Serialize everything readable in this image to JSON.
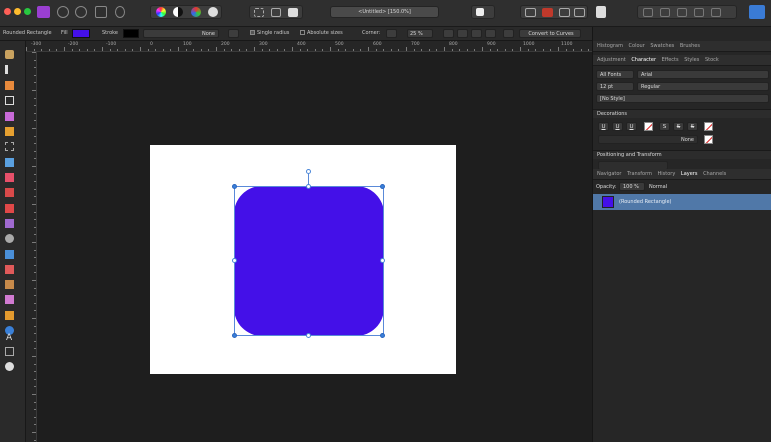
{
  "toolbar": {
    "doc_title": "<Untitled> [150.0%]",
    "icons": [
      "designer-persona-icon",
      "pixel-persona-icon",
      "export-persona-icon",
      "share-icon",
      "color-wheel-icon",
      "tone-icon",
      "color-icon",
      "snapping-icon",
      "order-icon",
      "align-icon",
      "boolean-icon",
      "help-icon",
      "studio-icon",
      "search-icon"
    ]
  },
  "context": {
    "object_label": "Rounded Rectangle",
    "fill_label": "Fill",
    "fill_color": "#4410e8",
    "stroke_label": "Stroke",
    "stroke_color": "#000000",
    "stroke_value": "None",
    "single_radius_label": "Single radius",
    "absolute_sizes_label": "Absolute sizes",
    "corner_label": "Corner:",
    "corner_value": "25 %",
    "convert_label": "Convert to Curves"
  },
  "ruler": {
    "top_labels": [
      "-300",
      "-200",
      "-100",
      "0",
      "100",
      "200",
      "300",
      "400",
      "500",
      "600",
      "700",
      "800",
      "900",
      "1000",
      "1100"
    ]
  },
  "panel": {
    "tabs_top": [
      "Histogram",
      "Colour",
      "Swatches",
      "Brushes"
    ],
    "tabs_char": [
      "Adjustment",
      "Character",
      "Effects",
      "Styles",
      "Stock"
    ],
    "font_collection": "All Fonts",
    "font_family": "Arial",
    "font_size": "12 pt",
    "font_style": "Regular",
    "text_style": "[No Style]",
    "decorations_label": "Decorations",
    "deco_none": "None",
    "positioning_label": "Positioning and Transform",
    "tabs_layers": [
      "Navigator",
      "Transform",
      "History",
      "Layers",
      "Channels"
    ],
    "opacity_label": "Opacity:",
    "opacity_value": "100 %",
    "blend_mode": "Normal",
    "layer_name": "(Rounded Rectangle)"
  },
  "colors": {
    "shape": "#4410e8",
    "selection": "#5078a8"
  }
}
